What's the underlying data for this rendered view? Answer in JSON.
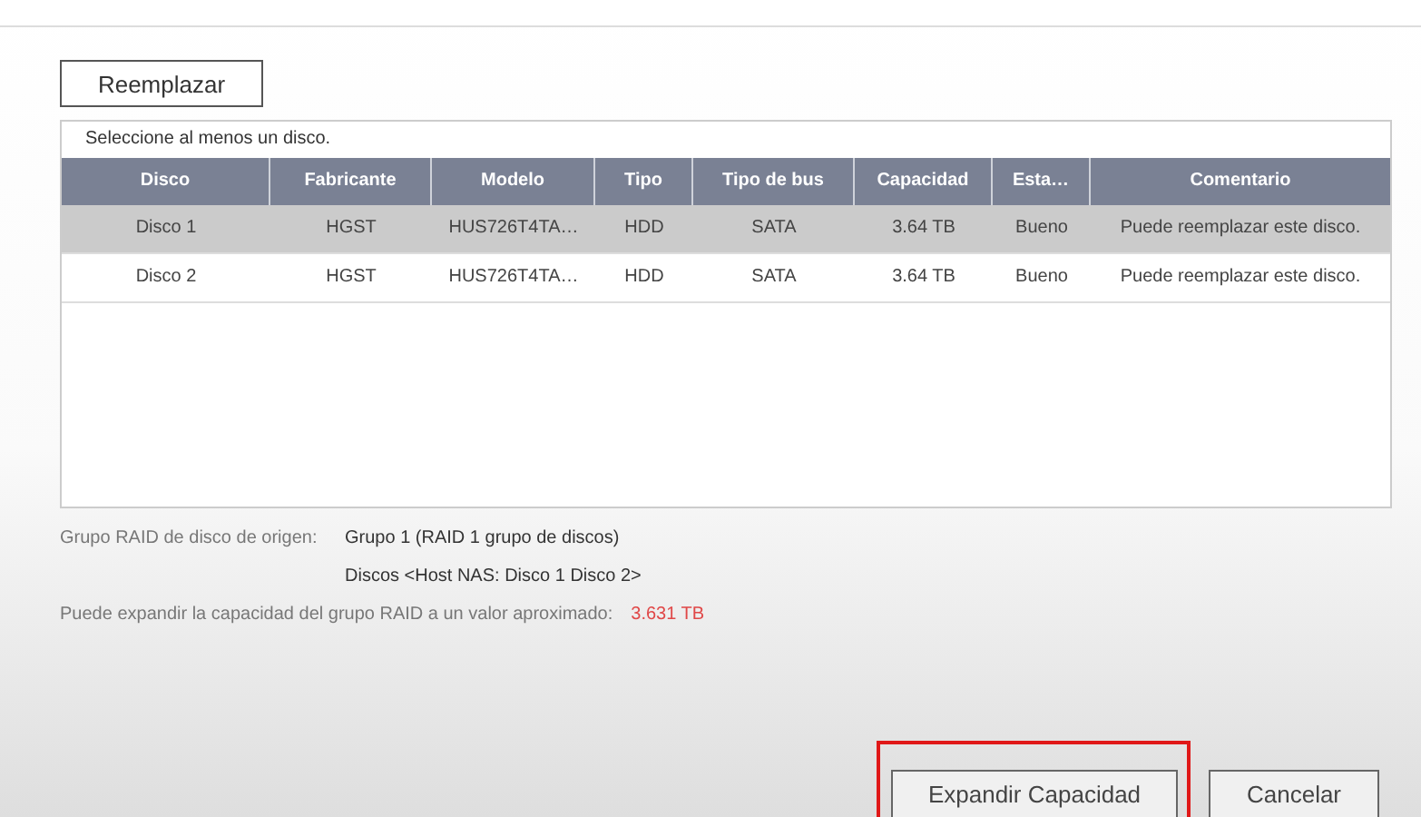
{
  "replace_button": "Reemplazar",
  "table": {
    "caption": "Seleccione al menos un disco.",
    "columns": [
      "Disco",
      "Fabricante",
      "Modelo",
      "Tipo",
      "Tipo de bus",
      "Capacidad",
      "Esta…",
      "Comentario"
    ],
    "rows": [
      {
        "selected": true,
        "cells": [
          "Disco 1",
          "HGST",
          "HUS726T4TA…",
          "HDD",
          "SATA",
          "3.64 TB",
          "Bueno",
          "Puede reemplazar este disco."
        ]
      },
      {
        "selected": false,
        "cells": [
          "Disco 2",
          "HGST",
          "HUS726T4TA…",
          "HDD",
          "SATA",
          "3.64 TB",
          "Bueno",
          "Puede reemplazar este disco."
        ]
      }
    ]
  },
  "source_group": {
    "label": "Grupo RAID de disco de origen:",
    "value": "Grupo 1 (RAID 1 grupo de discos)",
    "disks": "Discos <Host NAS: Disco 1 Disco 2>"
  },
  "expand_note": {
    "label": "Puede expandir la capacidad del grupo RAID a un valor aproximado:",
    "value": "3.631 TB"
  },
  "buttons": [
    {
      "label": "Expandir Capacidad",
      "highlighted": true
    },
    {
      "label": "Cancelar",
      "highlighted": false
    }
  ]
}
